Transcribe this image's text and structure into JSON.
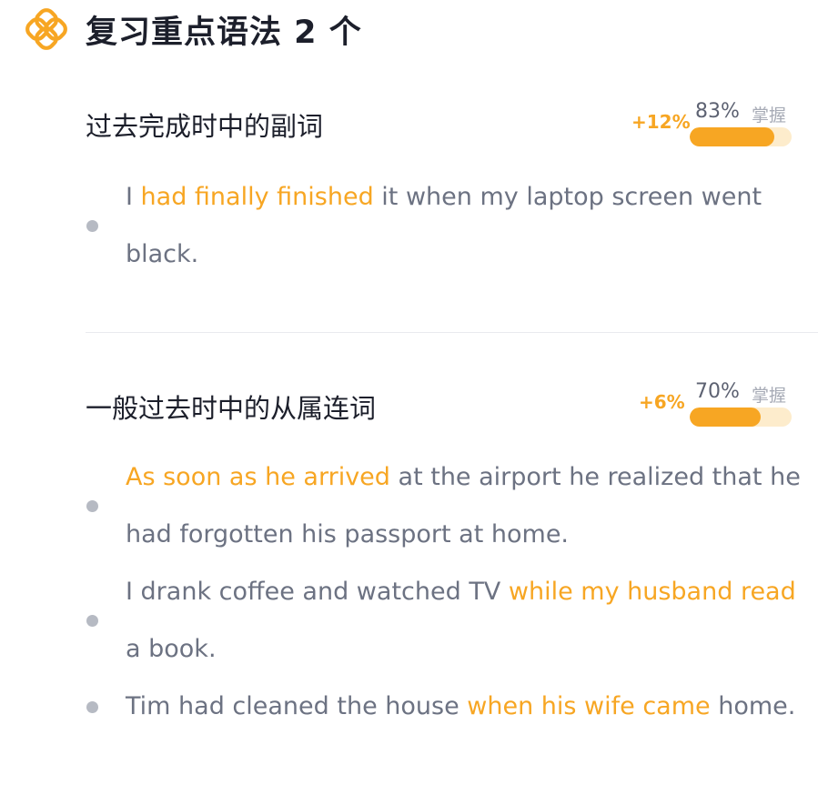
{
  "header": {
    "icon": "knot-icon",
    "title": "复习重点语法 2 个",
    "accent_color": "#f7a623"
  },
  "sections": [
    {
      "title": "过去完成时中的副词",
      "delta": "+12%",
      "percent_text": "83%",
      "mastery_label": "掌握",
      "progress": 0.83,
      "examples": [
        {
          "segments": [
            {
              "text": "I ",
              "highlight": false
            },
            {
              "text": "had finally finished",
              "highlight": true
            },
            {
              "text": " it when my laptop screen went black.",
              "highlight": false
            }
          ]
        }
      ]
    },
    {
      "title": "一般过去时中的从属连词",
      "delta": "+6%",
      "percent_text": "70%",
      "mastery_label": "掌握",
      "progress": 0.7,
      "examples": [
        {
          "segments": [
            {
              "text": "As soon as he arrived",
              "highlight": true
            },
            {
              "text": " at the airport he realized that he had forgotten his passport at home.",
              "highlight": false
            }
          ]
        },
        {
          "segments": [
            {
              "text": "I drank coffee and watched TV ",
              "highlight": false
            },
            {
              "text": "while my husband read",
              "highlight": true
            },
            {
              "text": " a book.",
              "highlight": false
            }
          ]
        },
        {
          "segments": [
            {
              "text": "Tim had cleaned the house ",
              "highlight": false
            },
            {
              "text": "when his wife came",
              "highlight": true
            },
            {
              "text": " home.",
              "highlight": false
            }
          ]
        }
      ]
    }
  ]
}
